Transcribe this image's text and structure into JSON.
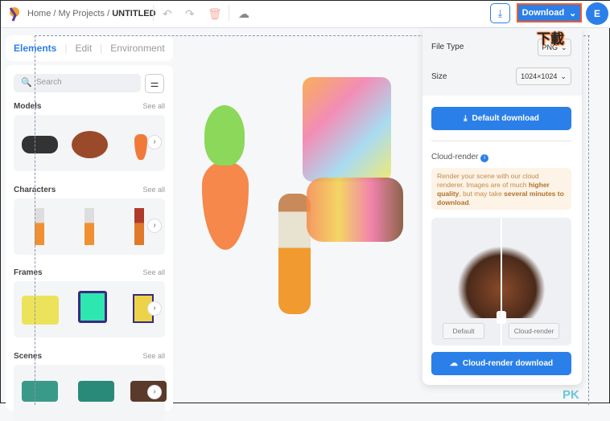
{
  "topbar": {
    "crumb_home": "Home",
    "crumb_sep": "/",
    "crumb_projects": "My Projects",
    "crumb_current": "UNTITLED",
    "download_label": "Download",
    "avatar_initial": "E",
    "annotation": "下載"
  },
  "sidebar": {
    "tabs": [
      {
        "label": "Elements"
      },
      {
        "label": "Edit"
      },
      {
        "label": "Environment"
      }
    ],
    "search_placeholder": "Search",
    "sections": [
      {
        "title": "Models",
        "see_all": "See all"
      },
      {
        "title": "Characters",
        "see_all": "See all"
      },
      {
        "title": "Frames",
        "see_all": "See all"
      },
      {
        "title": "Scenes",
        "see_all": "See all"
      }
    ]
  },
  "download_panel": {
    "file_type_label": "File Type",
    "file_type_value": "PNG",
    "size_label": "Size",
    "size_value": "1024×1024",
    "default_download": "Default download",
    "cloud_render_label": "Cloud-render",
    "info_1": "Render your scene with our cloud renderer. Images are of much ",
    "info_b1": "higher quality",
    "info_2": ", but may take ",
    "info_b2": "several minutes to download",
    "info_3": ".",
    "compare_default": "Default",
    "compare_cloud": "Cloud-render",
    "cloud_download": "Cloud-render download"
  },
  "watermark": "PK",
  "colors": {
    "accent": "#2b7fe8",
    "highlight": "#ff5a1f"
  }
}
